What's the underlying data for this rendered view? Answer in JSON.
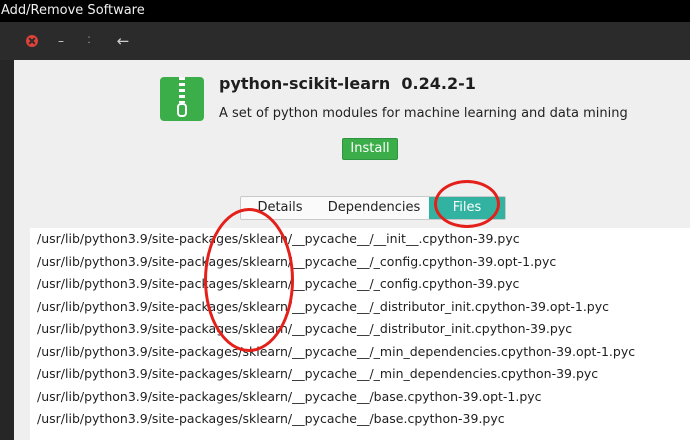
{
  "window": {
    "title": "Add/Remove Software"
  },
  "headerbar": {
    "close_icon": "close-icon",
    "minimize_label": "–",
    "restore_label": "⁚",
    "back_label": "←"
  },
  "package": {
    "name": "python-scikit-learn",
    "version": "0.24.2-1",
    "title": "python-scikit-learn  0.24.2-1",
    "description": "A set of python modules for machine learning and data mining",
    "install_label": "Install",
    "icon": "zip-archive-icon"
  },
  "tabs": [
    {
      "label": "Details",
      "active": false
    },
    {
      "label": "Dependencies",
      "active": false
    },
    {
      "label": "Files",
      "active": true
    }
  ],
  "files": [
    "/usr/lib/python3.9/site-packages/sklearn/__pycache__/__init__.cpython-39.pyc",
    "/usr/lib/python3.9/site-packages/sklearn/__pycache__/_config.cpython-39.opt-1.pyc",
    "/usr/lib/python3.9/site-packages/sklearn/__pycache__/_config.cpython-39.pyc",
    "/usr/lib/python3.9/site-packages/sklearn/__pycache__/_distributor_init.cpython-39.opt-1.pyc",
    "/usr/lib/python3.9/site-packages/sklearn/__pycache__/_distributor_init.cpython-39.pyc",
    "/usr/lib/python3.9/site-packages/sklearn/__pycache__/_min_dependencies.cpython-39.opt-1.pyc",
    "/usr/lib/python3.9/site-packages/sklearn/__pycache__/_min_dependencies.cpython-39.pyc",
    "/usr/lib/python3.9/site-packages/sklearn/__pycache__/base.cpython-39.opt-1.pyc",
    "/usr/lib/python3.9/site-packages/sklearn/__pycache__/base.cpython-39.pyc"
  ],
  "colors": {
    "accent_teal": "#32b2a1",
    "install_green": "#3bae4a",
    "annotation_red": "#e4201a"
  }
}
